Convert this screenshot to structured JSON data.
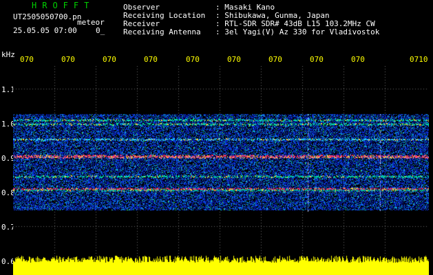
{
  "header": {
    "app_name": "HROFFT",
    "file_name": "UT2505050700.pn",
    "file_suffix": "meteor",
    "datetime": "25.05.05 07:00",
    "datetime_suffix": "0_"
  },
  "info": {
    "labels": [
      "Observer",
      "Receiving Location",
      "Receiver",
      "Receiving Antenna"
    ],
    "values": [
      ": Masaki Kano",
      ": Shibukawa, Gunma, Japan",
      ": RTL-SDR SDR# 43dB L15 103.2MHz CW",
      ": 3el Yagi(V) Az 330 for Vladivostok"
    ]
  },
  "axis": {
    "unit": "kHz",
    "time_labels": [
      "070",
      "070",
      "070",
      "070",
      "070",
      "070",
      "070",
      "070",
      "070",
      "0710"
    ],
    "freq_labels": [
      "1.1",
      "1.0",
      "0.9",
      "0.8",
      "0.7",
      "0.6"
    ]
  },
  "colors": {
    "background": "#000000",
    "app_name": "#00d000",
    "time_labels": "#ffff00",
    "signal_strong": "#ff3060",
    "signal_mid": "#00e0a0",
    "noise": "#1040ff",
    "bottom_bar": "#ffff00"
  }
}
